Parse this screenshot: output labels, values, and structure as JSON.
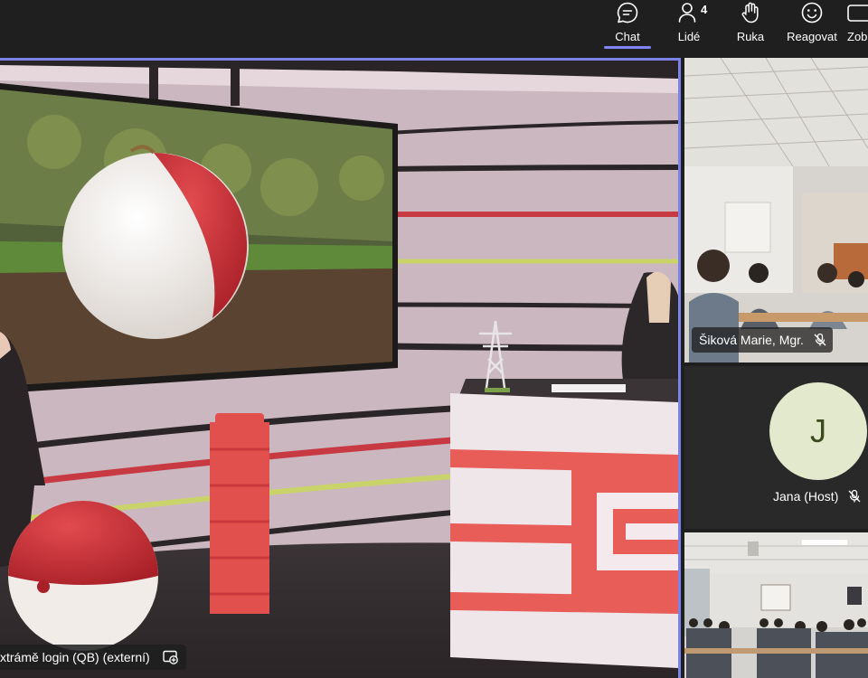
{
  "toolbar": {
    "items": [
      {
        "label": "Chat",
        "icon": "chat-icon",
        "active": true
      },
      {
        "label": "Lidé",
        "icon": "people-icon",
        "count": "4"
      },
      {
        "label": "Ruka",
        "icon": "raise-hand-icon"
      },
      {
        "label": "Reagovat",
        "icon": "react-icon"
      },
      {
        "label": "Zob",
        "icon": "view-icon"
      }
    ],
    "accent": "#7f85f5"
  },
  "stage": {
    "presenter_label": "xtrámě login (QB) (externí)",
    "share_icon": "screen-share-icon",
    "border_color": "#7b83eb"
  },
  "participants": [
    {
      "name": "Šiková Marie, Mgr.",
      "muted": true
    },
    {
      "name": "Jana (Host)",
      "initial": "J",
      "muted": true
    },
    {
      "name": ""
    }
  ]
}
